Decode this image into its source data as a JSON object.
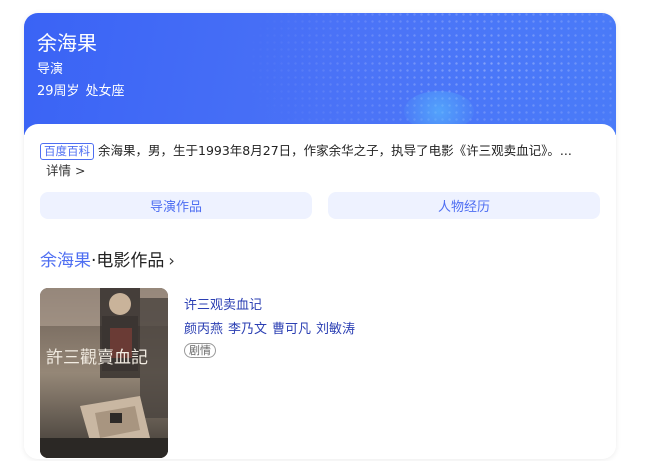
{
  "person": {
    "name": "余海果",
    "role": "导演",
    "age": "29周岁",
    "zodiac": "处女座"
  },
  "summary": {
    "source_tag": "百度百科",
    "text": "余海果，男，生于1993年8月27日，作家余华之子，执导了电影《许三观卖血记》。...",
    "detail_link": "详情 >"
  },
  "tabs": {
    "works": "导演作品",
    "bio": "人物经历"
  },
  "section": {
    "name": "余海果",
    "separator": "·",
    "title": "电影作品",
    "chevron": "›"
  },
  "movie": {
    "title": "许三观卖血记",
    "cast": [
      "颜丙燕",
      "李乃文",
      "曹可凡",
      "刘敏涛"
    ],
    "genre": "剧情",
    "poster_title": "許三觀賣血記"
  },
  "colors": {
    "accent": "#4e6ef2",
    "hero": "#3a63f5",
    "link": "#2b3fb3"
  }
}
